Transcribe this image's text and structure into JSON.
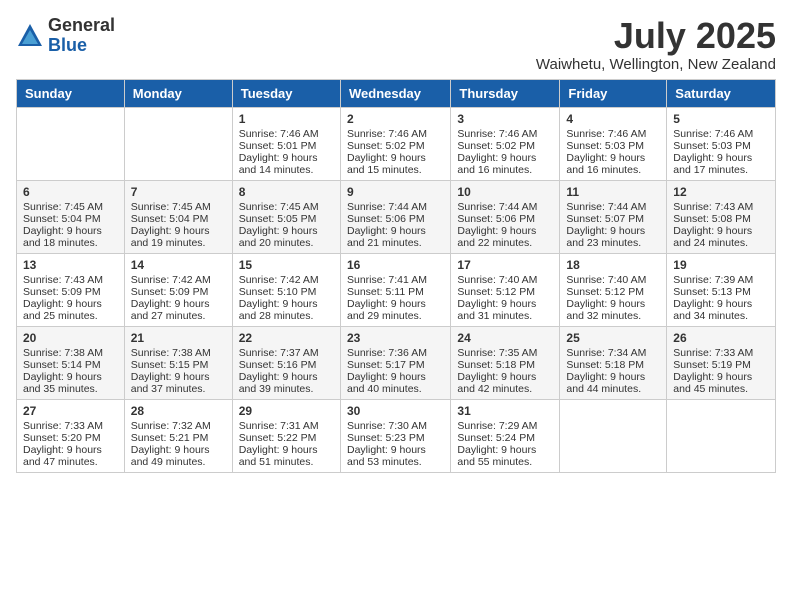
{
  "logo": {
    "general": "General",
    "blue": "Blue"
  },
  "title": "July 2025",
  "location": "Waiwhetu, Wellington, New Zealand",
  "weekdays": [
    "Sunday",
    "Monday",
    "Tuesday",
    "Wednesday",
    "Thursday",
    "Friday",
    "Saturday"
  ],
  "weeks": [
    [
      {
        "day": "",
        "sunrise": "",
        "sunset": "",
        "daylight": ""
      },
      {
        "day": "",
        "sunrise": "",
        "sunset": "",
        "daylight": ""
      },
      {
        "day": "1",
        "sunrise": "Sunrise: 7:46 AM",
        "sunset": "Sunset: 5:01 PM",
        "daylight": "Daylight: 9 hours and 14 minutes."
      },
      {
        "day": "2",
        "sunrise": "Sunrise: 7:46 AM",
        "sunset": "Sunset: 5:02 PM",
        "daylight": "Daylight: 9 hours and 15 minutes."
      },
      {
        "day": "3",
        "sunrise": "Sunrise: 7:46 AM",
        "sunset": "Sunset: 5:02 PM",
        "daylight": "Daylight: 9 hours and 16 minutes."
      },
      {
        "day": "4",
        "sunrise": "Sunrise: 7:46 AM",
        "sunset": "Sunset: 5:03 PM",
        "daylight": "Daylight: 9 hours and 16 minutes."
      },
      {
        "day": "5",
        "sunrise": "Sunrise: 7:46 AM",
        "sunset": "Sunset: 5:03 PM",
        "daylight": "Daylight: 9 hours and 17 minutes."
      }
    ],
    [
      {
        "day": "6",
        "sunrise": "Sunrise: 7:45 AM",
        "sunset": "Sunset: 5:04 PM",
        "daylight": "Daylight: 9 hours and 18 minutes."
      },
      {
        "day": "7",
        "sunrise": "Sunrise: 7:45 AM",
        "sunset": "Sunset: 5:04 PM",
        "daylight": "Daylight: 9 hours and 19 minutes."
      },
      {
        "day": "8",
        "sunrise": "Sunrise: 7:45 AM",
        "sunset": "Sunset: 5:05 PM",
        "daylight": "Daylight: 9 hours and 20 minutes."
      },
      {
        "day": "9",
        "sunrise": "Sunrise: 7:44 AM",
        "sunset": "Sunset: 5:06 PM",
        "daylight": "Daylight: 9 hours and 21 minutes."
      },
      {
        "day": "10",
        "sunrise": "Sunrise: 7:44 AM",
        "sunset": "Sunset: 5:06 PM",
        "daylight": "Daylight: 9 hours and 22 minutes."
      },
      {
        "day": "11",
        "sunrise": "Sunrise: 7:44 AM",
        "sunset": "Sunset: 5:07 PM",
        "daylight": "Daylight: 9 hours and 23 minutes."
      },
      {
        "day": "12",
        "sunrise": "Sunrise: 7:43 AM",
        "sunset": "Sunset: 5:08 PM",
        "daylight": "Daylight: 9 hours and 24 minutes."
      }
    ],
    [
      {
        "day": "13",
        "sunrise": "Sunrise: 7:43 AM",
        "sunset": "Sunset: 5:09 PM",
        "daylight": "Daylight: 9 hours and 25 minutes."
      },
      {
        "day": "14",
        "sunrise": "Sunrise: 7:42 AM",
        "sunset": "Sunset: 5:09 PM",
        "daylight": "Daylight: 9 hours and 27 minutes."
      },
      {
        "day": "15",
        "sunrise": "Sunrise: 7:42 AM",
        "sunset": "Sunset: 5:10 PM",
        "daylight": "Daylight: 9 hours and 28 minutes."
      },
      {
        "day": "16",
        "sunrise": "Sunrise: 7:41 AM",
        "sunset": "Sunset: 5:11 PM",
        "daylight": "Daylight: 9 hours and 29 minutes."
      },
      {
        "day": "17",
        "sunrise": "Sunrise: 7:40 AM",
        "sunset": "Sunset: 5:12 PM",
        "daylight": "Daylight: 9 hours and 31 minutes."
      },
      {
        "day": "18",
        "sunrise": "Sunrise: 7:40 AM",
        "sunset": "Sunset: 5:12 PM",
        "daylight": "Daylight: 9 hours and 32 minutes."
      },
      {
        "day": "19",
        "sunrise": "Sunrise: 7:39 AM",
        "sunset": "Sunset: 5:13 PM",
        "daylight": "Daylight: 9 hours and 34 minutes."
      }
    ],
    [
      {
        "day": "20",
        "sunrise": "Sunrise: 7:38 AM",
        "sunset": "Sunset: 5:14 PM",
        "daylight": "Daylight: 9 hours and 35 minutes."
      },
      {
        "day": "21",
        "sunrise": "Sunrise: 7:38 AM",
        "sunset": "Sunset: 5:15 PM",
        "daylight": "Daylight: 9 hours and 37 minutes."
      },
      {
        "day": "22",
        "sunrise": "Sunrise: 7:37 AM",
        "sunset": "Sunset: 5:16 PM",
        "daylight": "Daylight: 9 hours and 39 minutes."
      },
      {
        "day": "23",
        "sunrise": "Sunrise: 7:36 AM",
        "sunset": "Sunset: 5:17 PM",
        "daylight": "Daylight: 9 hours and 40 minutes."
      },
      {
        "day": "24",
        "sunrise": "Sunrise: 7:35 AM",
        "sunset": "Sunset: 5:18 PM",
        "daylight": "Daylight: 9 hours and 42 minutes."
      },
      {
        "day": "25",
        "sunrise": "Sunrise: 7:34 AM",
        "sunset": "Sunset: 5:18 PM",
        "daylight": "Daylight: 9 hours and 44 minutes."
      },
      {
        "day": "26",
        "sunrise": "Sunrise: 7:33 AM",
        "sunset": "Sunset: 5:19 PM",
        "daylight": "Daylight: 9 hours and 45 minutes."
      }
    ],
    [
      {
        "day": "27",
        "sunrise": "Sunrise: 7:33 AM",
        "sunset": "Sunset: 5:20 PM",
        "daylight": "Daylight: 9 hours and 47 minutes."
      },
      {
        "day": "28",
        "sunrise": "Sunrise: 7:32 AM",
        "sunset": "Sunset: 5:21 PM",
        "daylight": "Daylight: 9 hours and 49 minutes."
      },
      {
        "day": "29",
        "sunrise": "Sunrise: 7:31 AM",
        "sunset": "Sunset: 5:22 PM",
        "daylight": "Daylight: 9 hours and 51 minutes."
      },
      {
        "day": "30",
        "sunrise": "Sunrise: 7:30 AM",
        "sunset": "Sunset: 5:23 PM",
        "daylight": "Daylight: 9 hours and 53 minutes."
      },
      {
        "day": "31",
        "sunrise": "Sunrise: 7:29 AM",
        "sunset": "Sunset: 5:24 PM",
        "daylight": "Daylight: 9 hours and 55 minutes."
      },
      {
        "day": "",
        "sunrise": "",
        "sunset": "",
        "daylight": ""
      },
      {
        "day": "",
        "sunrise": "",
        "sunset": "",
        "daylight": ""
      }
    ]
  ]
}
